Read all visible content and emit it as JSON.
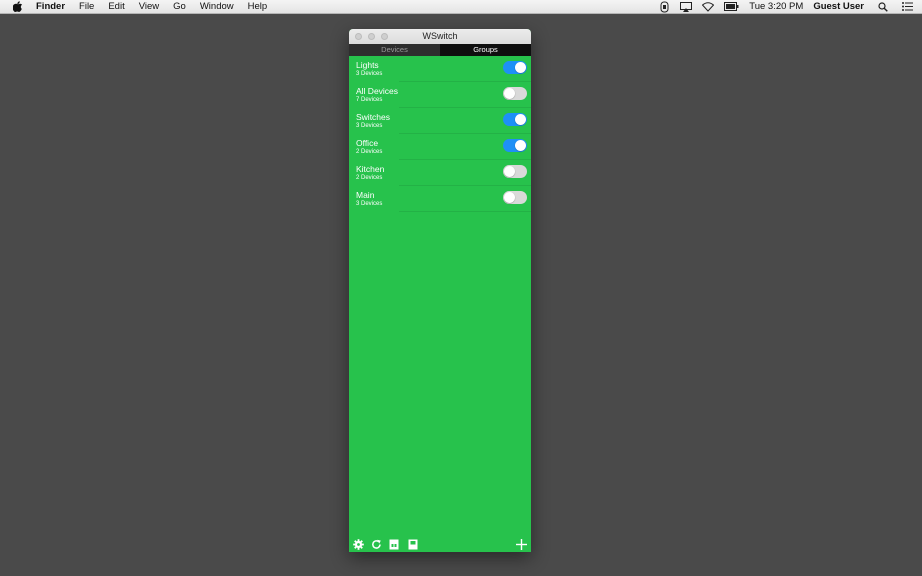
{
  "menubar": {
    "app_name": "Finder",
    "items": [
      "File",
      "Edit",
      "View",
      "Go",
      "Window",
      "Help"
    ],
    "clock": "Tue 3:20 PM",
    "user": "Guest User",
    "status_icons": [
      "screen-icon",
      "airplay-icon",
      "wifi-icon",
      "battery-icon",
      "spotlight-icon",
      "notification-center-icon"
    ]
  },
  "window": {
    "title": "WSwitch",
    "tabs": [
      {
        "label": "Devices",
        "selected": false
      },
      {
        "label": "Groups",
        "selected": true
      }
    ],
    "background_color": "#27c24c",
    "toggle_on_color": "#1e90f6",
    "groups": [
      {
        "name": "Lights",
        "count": "3 Devices",
        "on": true
      },
      {
        "name": "All Devices",
        "count": "7 Devices",
        "on": false
      },
      {
        "name": "Switches",
        "count": "3 Devices",
        "on": true
      },
      {
        "name": "Office",
        "count": "2 Devices",
        "on": true
      },
      {
        "name": "Kitchen",
        "count": "2 Devices",
        "on": false
      },
      {
        "name": "Main",
        "count": "3 Devices",
        "on": false
      }
    ],
    "toolbar_icons": [
      "gear-icon",
      "refresh-icon",
      "device-icon",
      "device-alt-icon",
      "plus-icon"
    ]
  }
}
